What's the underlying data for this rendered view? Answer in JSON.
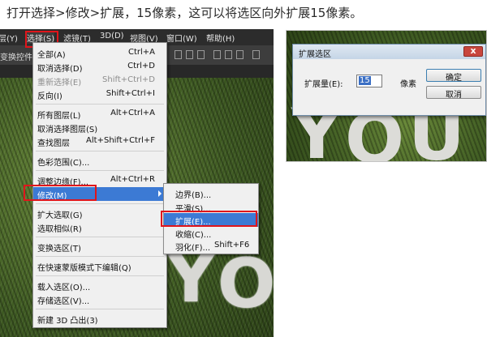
{
  "caption": "打开选择>修改>扩展，15像素，这可以将选区向外扩展15像素。",
  "menubar": [
    {
      "label": "层(Y)",
      "id": "layer"
    },
    {
      "label": "选择(S)",
      "id": "select"
    },
    {
      "label": "滤镜(T)",
      "id": "filter"
    },
    {
      "label": "3D(D)",
      "id": "3d"
    },
    {
      "label": "视图(V)",
      "id": "view"
    },
    {
      "label": "窗口(W)",
      "id": "window"
    },
    {
      "label": "帮助(H)",
      "id": "help"
    }
  ],
  "options_bar": {
    "text": "变换控件"
  },
  "canvas_letters": [
    "Y",
    "O"
  ],
  "select_menu": [
    {
      "label": "全部(A)",
      "shortcut": "Ctrl+A",
      "disabled": false
    },
    {
      "label": "取消选择(D)",
      "shortcut": "Ctrl+D",
      "disabled": false
    },
    {
      "label": "重新选择(E)",
      "shortcut": "Shift+Ctrl+D",
      "disabled": true
    },
    {
      "label": "反向(I)",
      "shortcut": "Shift+Ctrl+I",
      "disabled": false
    },
    {
      "label": "所有图层(L)",
      "shortcut": "Alt+Ctrl+A",
      "disabled": false
    },
    {
      "label": "取消选择图层(S)",
      "shortcut": "",
      "disabled": false
    },
    {
      "label": "查找图层",
      "shortcut": "Alt+Shift+Ctrl+F",
      "disabled": false
    },
    {
      "label": "色彩范围(C)...",
      "shortcut": "",
      "disabled": false
    },
    {
      "label": "调整边缘(F)...",
      "shortcut": "Alt+Ctrl+R",
      "disabled": false
    },
    {
      "label": "修改(M)",
      "shortcut": "",
      "disabled": false
    },
    {
      "label": "扩大选取(G)",
      "shortcut": "",
      "disabled": false
    },
    {
      "label": "选取相似(R)",
      "shortcut": "",
      "disabled": false
    },
    {
      "label": "变换选区(T)",
      "shortcut": "",
      "disabled": false
    },
    {
      "label": "在快速蒙版模式下编辑(Q)",
      "shortcut": "",
      "disabled": false
    },
    {
      "label": "载入选区(O)...",
      "shortcut": "",
      "disabled": false
    },
    {
      "label": "存储选区(V)...",
      "shortcut": "",
      "disabled": false
    },
    {
      "label": "新建 3D 凸出(3)",
      "shortcut": "",
      "disabled": false
    }
  ],
  "modify_submenu": [
    {
      "label": "边界(B)...",
      "shortcut": ""
    },
    {
      "label": "平滑(S)...",
      "shortcut": ""
    },
    {
      "label": "扩展(E)...",
      "shortcut": ""
    },
    {
      "label": "收缩(C)...",
      "shortcut": ""
    },
    {
      "label": "羽化(F)...",
      "shortcut": "Shift+F6"
    }
  ],
  "dialog": {
    "title": "扩展选区",
    "field_label": "扩展量(E):",
    "value": "15",
    "unit": "像素",
    "ok": "确定",
    "cancel": "取消",
    "close": "x"
  },
  "colors": {
    "highlight": "#3c7ad4",
    "annotation_red": "#e0151b"
  }
}
